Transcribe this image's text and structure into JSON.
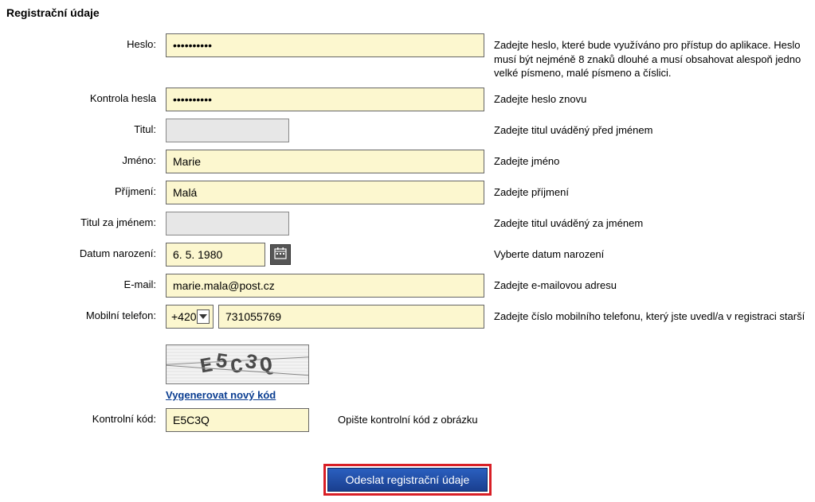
{
  "title": "Registrační údaje",
  "fields": {
    "password": {
      "label": "Heslo:",
      "hint": "Zadejte heslo, které bude využíváno pro přístup do aplikace. Heslo musí být nejméně 8 znaků dlouhé a musí obsahovat alespoň jedno velké písmeno, malé písmeno a číslici."
    },
    "password2": {
      "label": "Kontrola hesla",
      "hint": "Zadejte heslo znovu"
    },
    "titleBefore": {
      "label": "Titul:",
      "hint": "Zadejte titul uváděný před jménem"
    },
    "firstName": {
      "label": "Jméno:",
      "value": "Marie",
      "hint": "Zadejte jméno"
    },
    "lastName": {
      "label": "Příjmení:",
      "value": "Malá",
      "hint": "Zadejte příjmení"
    },
    "titleAfter": {
      "label": "Titul za jménem:",
      "hint": "Zadejte titul uváděný za jménem"
    },
    "dob": {
      "label": "Datum narození:",
      "value": "6. 5. 1980",
      "hint": "Vyberte datum narození"
    },
    "email": {
      "label": "E-mail:",
      "value": "marie.mala@post.cz",
      "hint": "Zadejte e-mailovou adresu"
    },
    "phone": {
      "label": "Mobilní telefon:",
      "prefix": "+420",
      "value": "731055769",
      "hint": "Zadejte číslo mobilního telefonu, který jste uvedl/a v registraci starší"
    },
    "captcha": {
      "image_text": "E5C3Q",
      "regen_label": "Vygenerovat nový kód"
    },
    "controlCode": {
      "label": "Kontrolní kód:",
      "value": "E5C3Q",
      "hint": "Opište kontrolní kód z obrázku"
    }
  },
  "submit_label": "Odeslat registrační údaje"
}
